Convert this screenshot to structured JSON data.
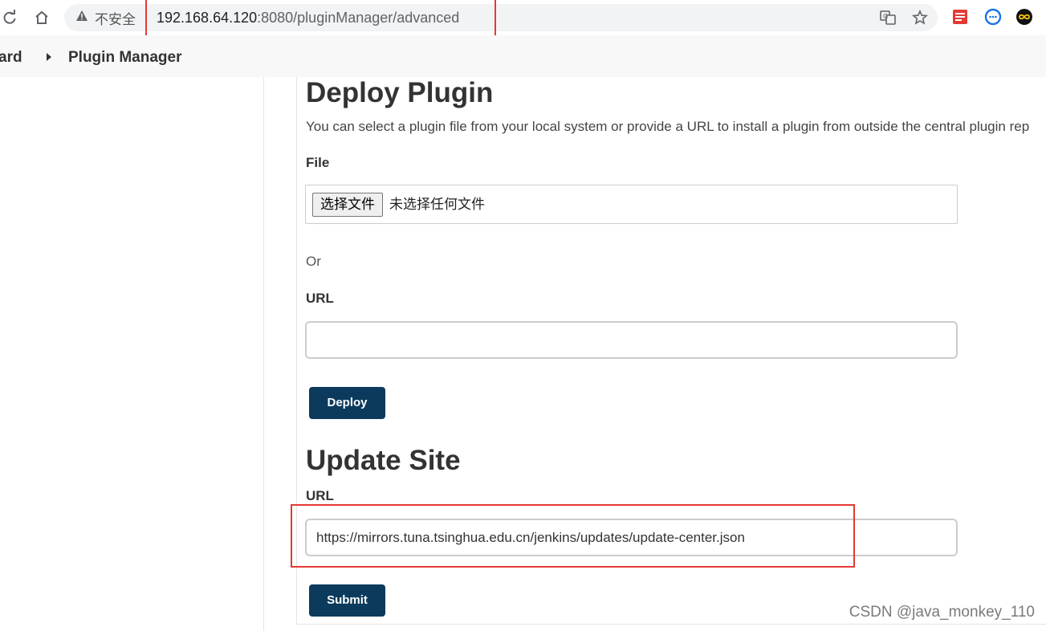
{
  "browser": {
    "security_label": "不安全",
    "url_host": "192.168.64.120",
    "url_rest": ":8080/pluginManager/advanced"
  },
  "breadcrumb": {
    "items": [
      "ard",
      "Plugin Manager"
    ]
  },
  "deploy": {
    "title": "Deploy Plugin",
    "description": "You can select a plugin file from your local system or provide a URL to install a plugin from outside the central plugin rep",
    "file_label": "File",
    "choose_file_button": "选择文件",
    "file_status": "未选择任何文件",
    "or_label": "Or",
    "url_label": "URL",
    "url_value": "",
    "deploy_button": "Deploy"
  },
  "update_site": {
    "title": "Update Site",
    "url_label": "URL",
    "url_value": "https://mirrors.tuna.tsinghua.edu.cn/jenkins/updates/update-center.json",
    "submit_button": "Submit"
  },
  "watermark": "CSDN @java_monkey_110",
  "colors": {
    "primary_button": "#0b3a5c",
    "highlight_box": "#e53935"
  }
}
